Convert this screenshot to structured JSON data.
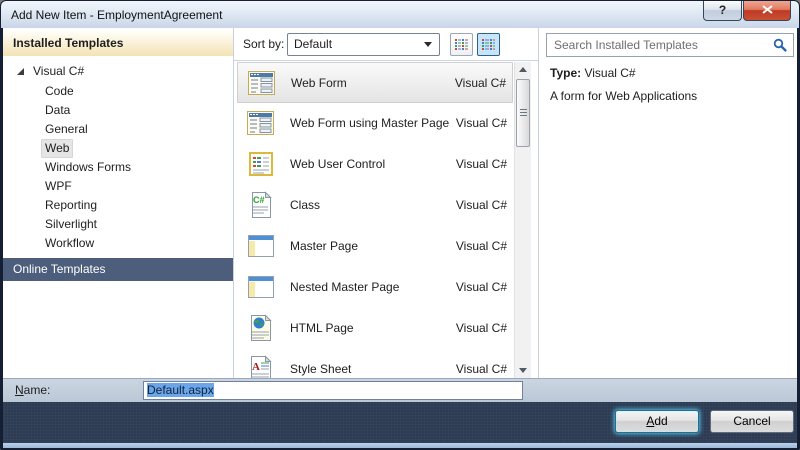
{
  "window": {
    "title": "Add New Item - EmploymentAgreement",
    "help_glyph": "?"
  },
  "sidebar": {
    "installed_header": "Installed Templates",
    "online_header": "Online Templates",
    "root_label": "Visual C#",
    "items": [
      "Code",
      "Data",
      "General",
      "Web",
      "Windows Forms",
      "WPF",
      "Reporting",
      "Silverlight",
      "Workflow"
    ],
    "selected_category": "Web"
  },
  "toolbar": {
    "sort_label": "Sort by:",
    "sort_value": "Default"
  },
  "search": {
    "placeholder": "Search Installed Templates"
  },
  "list": {
    "selected_item": "Web Form",
    "items": [
      {
        "label": "Web Form",
        "type": "Visual C#",
        "icon": "web-form-icon",
        "selected": true
      },
      {
        "label": "Web Form using Master Page",
        "type": "Visual C#",
        "icon": "web-form-icon",
        "selected": false
      },
      {
        "label": "Web User Control",
        "type": "Visual C#",
        "icon": "web-user-control-icon",
        "selected": false
      },
      {
        "label": "Class",
        "type": "Visual C#",
        "icon": "csharp-class-icon",
        "selected": false
      },
      {
        "label": "Master Page",
        "type": "Visual C#",
        "icon": "master-page-icon",
        "selected": false
      },
      {
        "label": "Nested Master Page",
        "type": "Visual C#",
        "icon": "master-page-icon",
        "selected": false
      },
      {
        "label": "HTML Page",
        "type": "Visual C#",
        "icon": "html-page-icon",
        "selected": false
      },
      {
        "label": "Style Sheet",
        "type": "Visual C#",
        "icon": "style-sheet-icon",
        "selected": false
      }
    ]
  },
  "details": {
    "type_label": "Type:",
    "type_value": "Visual C#",
    "description": "A form for Web Applications"
  },
  "footer": {
    "name_mnemonic": "N",
    "name_rest": "ame:",
    "name_value": "Default.aspx",
    "add_mnemonic": "A",
    "add_rest": "dd",
    "cancel_label": "Cancel"
  },
  "colors": {
    "header_gold_bg": "#F3E3B5",
    "online_header_bg": "#4C5E7C",
    "footer_bg": "#2B3A52",
    "selection_blue": "#6CA6E8",
    "add_glow": "rgba(88,199,240,0.95)",
    "search_icon_blue": "#2A66B0"
  }
}
